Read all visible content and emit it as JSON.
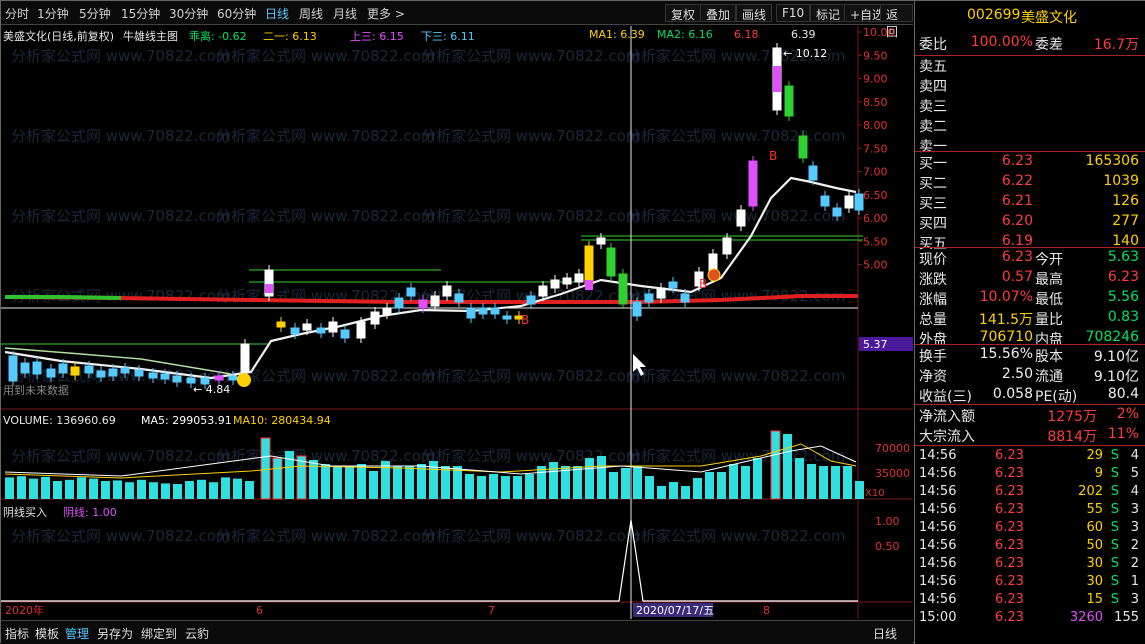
{
  "periods": [
    "分时",
    "1分钟",
    "5分钟",
    "15分钟",
    "30分钟",
    "60分钟",
    "日线",
    "周线",
    "月线",
    "更多 >"
  ],
  "active_period": "日线",
  "toolbar": [
    "复权",
    "叠加",
    "画线",
    "F10",
    "标记",
    "+自选",
    "返回"
  ],
  "header": {
    "stock": "美盛文化(日线,前复权)",
    "indicator": "牛雄线主图",
    "guali": "乖离: -0.62",
    "eryi": "二一: 6.13",
    "shangsan": "上三: 6.15",
    "xiasan": "下三: 6.11",
    "ma1": "MA1: 6.39",
    "ma2": "MA2: 6.16",
    "m1": "6.18",
    "m2": "6.39"
  },
  "price_axis": [
    "10.00",
    "9.50",
    "9.00",
    "8.50",
    "8.00",
    "7.50",
    "7.00",
    "6.50",
    "6.00",
    "5.50",
    "5.00"
  ],
  "price_current": "5.37",
  "annotations": {
    "high": "10.12",
    "low": "4.84",
    "future": "用到未来数据",
    "b1": "B",
    "b2": "B",
    "b3": "B"
  },
  "volume": {
    "label": "VOLUME: 136960.69",
    "ma5": "MA5: 299053.91",
    "ma10": "MA10: 280434.94",
    "axis": [
      "70000",
      "35000"
    ],
    "scale": "X10"
  },
  "ind3": {
    "label": "阴线买入",
    "value": "阴线: 1.00",
    "axis": [
      "1.00",
      "0.50"
    ]
  },
  "dates": {
    "year": "2020年",
    "m6": "6",
    "m7": "7",
    "m8": "8",
    "cursor": "2020/07/17/五"
  },
  "bottom_tabs": [
    "指标",
    "模板",
    "管理",
    "另存为",
    "绑定到",
    "云豹"
  ],
  "bottom_right": "日线",
  "watermark": "分析家公式网 www.70822.com",
  "right": {
    "code": "002699",
    "name": "美盛文化",
    "weibi": {
      "label": "委比",
      "v": "100.00%",
      "label2": "委差",
      "v2": "16.7万"
    },
    "sells": [
      "卖五",
      "卖四",
      "卖三",
      "卖二",
      "卖一"
    ],
    "buys": [
      {
        "l": "买一",
        "p": "6.23",
        "v": "165306"
      },
      {
        "l": "买二",
        "p": "6.22",
        "v": "1039"
      },
      {
        "l": "买三",
        "p": "6.21",
        "v": "126"
      },
      {
        "l": "买四",
        "p": "6.20",
        "v": "277"
      },
      {
        "l": "买五",
        "p": "6.19",
        "v": "140"
      }
    ],
    "stats": [
      {
        "l": "现价",
        "v": "6.23",
        "l2": "今开",
        "v2": "5.63"
      },
      {
        "l": "涨跌",
        "v": "0.57",
        "l2": "最高",
        "v2": "6.23"
      },
      {
        "l": "涨幅",
        "v": "10.07%",
        "l2": "最低",
        "v2": "5.56"
      },
      {
        "l": "总量",
        "v": "141.5万",
        "l2": "量比",
        "v2": "0.83"
      },
      {
        "l": "外盘",
        "v": "706710",
        "l2": "内盘",
        "v2": "708246"
      },
      {
        "l": "换手",
        "v": "15.56%",
        "l2": "股本",
        "v2": "9.10亿"
      },
      {
        "l": "净资",
        "v": "2.50",
        "l2": "流通",
        "v2": "9.10亿"
      },
      {
        "l": "收益(三)",
        "v": "0.058",
        "l2": "PE(动)",
        "v2": "80.4"
      }
    ],
    "flows": [
      {
        "l": "净流入额",
        "v": "1275万",
        "p": "2%"
      },
      {
        "l": "大宗流入",
        "v": "8814万",
        "p": "11%"
      }
    ],
    "ticks": [
      {
        "t": "14:56",
        "p": "6.23",
        "v": "29",
        "s": "S",
        "c": "4"
      },
      {
        "t": "14:56",
        "p": "6.23",
        "v": "9",
        "s": "S",
        "c": "5"
      },
      {
        "t": "14:56",
        "p": "6.23",
        "v": "202",
        "s": "S",
        "c": "4"
      },
      {
        "t": "14:56",
        "p": "6.23",
        "v": "55",
        "s": "S",
        "c": "3"
      },
      {
        "t": "14:56",
        "p": "6.23",
        "v": "60",
        "s": "S",
        "c": "3"
      },
      {
        "t": "14:56",
        "p": "6.23",
        "v": "50",
        "s": "S",
        "c": "2"
      },
      {
        "t": "14:56",
        "p": "6.23",
        "v": "30",
        "s": "S",
        "c": "2"
      },
      {
        "t": "14:56",
        "p": "6.23",
        "v": "30",
        "s": "S",
        "c": "1"
      },
      {
        "t": "14:56",
        "p": "6.23",
        "v": "15",
        "s": "S",
        "c": "3"
      },
      {
        "t": "15:00",
        "p": "6.23",
        "v": "3260",
        "s": "",
        "c": "155"
      }
    ]
  }
}
